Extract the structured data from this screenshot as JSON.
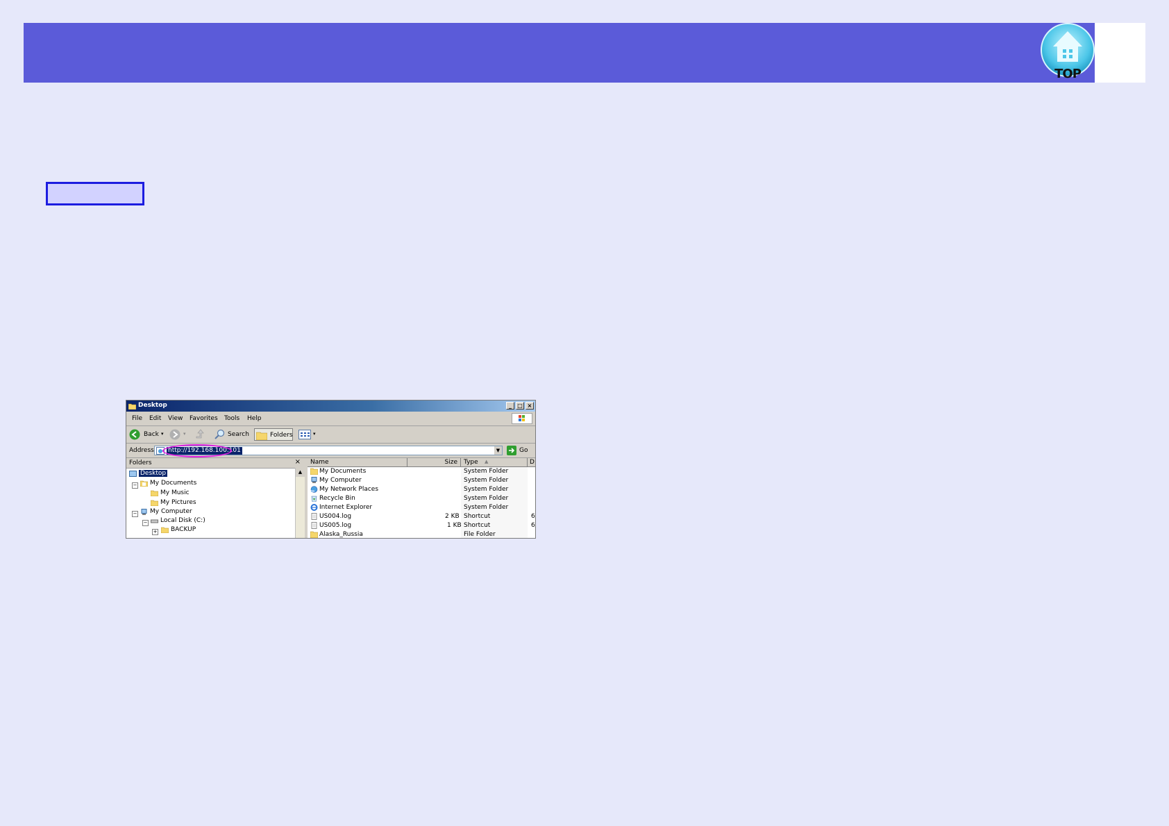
{
  "header": {
    "top_label": "TOP",
    "band_color": "#5b5bd9",
    "icon": "house-icon"
  },
  "explorer": {
    "title": "Desktop",
    "window_buttons": [
      "_",
      "□",
      "×"
    ],
    "menu": [
      "File",
      "Edit",
      "View",
      "Favorites",
      "Tools",
      "Help"
    ],
    "toolbar": {
      "back": "Back",
      "search": "Search",
      "folders": "Folders"
    },
    "address": {
      "label": "Address",
      "value": "http://192.168.100.101",
      "go": "Go",
      "highlight_color": "#e020e0"
    },
    "folders_pane": {
      "title": "Folders",
      "close": "×",
      "items": [
        {
          "label": "Desktop",
          "selected": true,
          "icon": "desktop-icon"
        },
        {
          "label": "My Documents",
          "expander": "−",
          "icon": "documents-icon"
        },
        {
          "label": "My Music",
          "icon": "folder-icon"
        },
        {
          "label": "My Pictures",
          "icon": "folder-icon"
        },
        {
          "label": "My Computer",
          "expander": "−",
          "icon": "computer-icon"
        },
        {
          "label": "Local Disk (C:)",
          "expander": "−",
          "icon": "disk-icon"
        },
        {
          "label": "BACKUP",
          "expander": "+",
          "icon": "folder-icon"
        }
      ]
    },
    "files_pane": {
      "columns": {
        "name": "Name",
        "size": "Size",
        "type": "Type",
        "date": "D"
      },
      "rows": [
        {
          "name": "My Documents",
          "size": "",
          "type": "System Folder",
          "date": "",
          "icon": "documents-icon"
        },
        {
          "name": "My Computer",
          "size": "",
          "type": "System Folder",
          "date": "",
          "icon": "computer-icon"
        },
        {
          "name": "My Network Places",
          "size": "",
          "type": "System Folder",
          "date": "",
          "icon": "network-icon"
        },
        {
          "name": "Recycle Bin",
          "size": "",
          "type": "System Folder",
          "date": "",
          "icon": "recycle-bin-icon"
        },
        {
          "name": "Internet Explorer",
          "size": "",
          "type": "System Folder",
          "date": "",
          "icon": "ie-icon"
        },
        {
          "name": "US004.log",
          "size": "2 KB",
          "type": "Shortcut",
          "date": "6/",
          "icon": "file-icon"
        },
        {
          "name": "US005.log",
          "size": "1 KB",
          "type": "Shortcut",
          "date": "6/",
          "icon": "file-icon"
        },
        {
          "name": "Alaska_Russia",
          "size": "",
          "type": "File Folder",
          "date": "",
          "icon": "folder-icon"
        }
      ]
    }
  }
}
